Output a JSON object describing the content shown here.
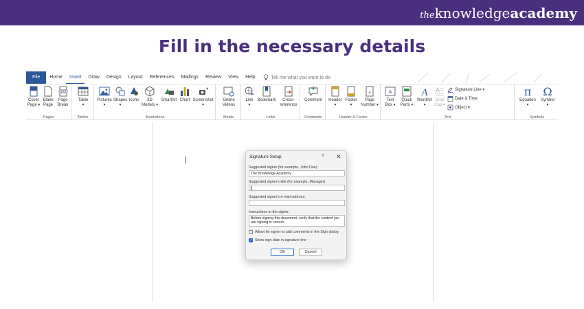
{
  "brand": {
    "the": "the",
    "knowledge": "knowledge",
    "academy": "academy"
  },
  "headline": "Fill in the necessary details",
  "ribbon": {
    "tabs": [
      "File",
      "Home",
      "Insert",
      "Draw",
      "Design",
      "Layout",
      "References",
      "Mailings",
      "Review",
      "View",
      "Help"
    ],
    "active_tab": "Insert",
    "tell_me": "Tell me what you want to do",
    "groups": {
      "pages": "Pages",
      "tables": "Tables",
      "illustrations": "Illustrations",
      "media": "Media",
      "links": "Links",
      "comments": "Comments",
      "header_footer": "Header & Footer",
      "text": "Text",
      "symbols": "Symbols"
    },
    "buttons": {
      "cover_page": [
        "Cover",
        "Page ▾"
      ],
      "blank_page": [
        "Blank",
        "Page"
      ],
      "page_break": [
        "Page",
        "Break"
      ],
      "table": [
        "Table",
        "▾"
      ],
      "pictures": [
        "Pictures",
        "▾"
      ],
      "shapes": [
        "Shapes",
        "▾"
      ],
      "icons": [
        "Icons",
        ""
      ],
      "models_3d": [
        "3D",
        "Models ▾"
      ],
      "smartart": [
        "SmartArt",
        ""
      ],
      "chart": [
        "Chart",
        ""
      ],
      "screenshot": [
        "Screenshot",
        "▾"
      ],
      "online_videos": [
        "Online",
        "Videos"
      ],
      "link": [
        "Link",
        "▾"
      ],
      "bookmark": [
        "Bookmark",
        ""
      ],
      "cross_reference": [
        "Cross-",
        "reference"
      ],
      "comment": [
        "Comment",
        ""
      ],
      "header": [
        "Header",
        "▾"
      ],
      "footer": [
        "Footer",
        "▾"
      ],
      "page_number": [
        "Page",
        "Number ▾"
      ],
      "text_box": [
        "Text",
        "Box ▾"
      ],
      "quick_parts": [
        "Quick",
        "Parts ▾"
      ],
      "wordart": [
        "WordArt",
        "▾"
      ],
      "drop_cap": [
        "Drop",
        "Cap ▾"
      ],
      "signature_line": "Signature Line ▾",
      "date_time": "Date & Time",
      "object": "Object ▾",
      "equation": [
        "Equation",
        "▾"
      ],
      "symbol": [
        "Symbol",
        "▾"
      ]
    }
  },
  "dialog": {
    "title": "Signature Setup",
    "help": "?",
    "close": "✕",
    "signer_label": "Suggested signer (for example, John Doe):",
    "signer_value": "The Knowledge Academy",
    "title_label": "Suggested signer's title (for example, Manager):",
    "title_value": "",
    "email_label": "Suggested signer's e-mail address:",
    "email_value": "",
    "instructions_label": "Instructions to the signer:",
    "instructions_value": "Before signing this document, verify that the content you are signing is correct.",
    "allow_comments_label": "Allow the signer to add comments in the Sign dialog",
    "allow_comments_checked": false,
    "show_date_label": "Show sign date in signature line",
    "show_date_checked": true,
    "ok": "OK",
    "cancel": "Cancel"
  },
  "colors": {
    "banner": "#4a2f7f",
    "headline": "#4a2f7f",
    "word_blue": "#2b579a",
    "checkbox": "#2b6cc4"
  }
}
